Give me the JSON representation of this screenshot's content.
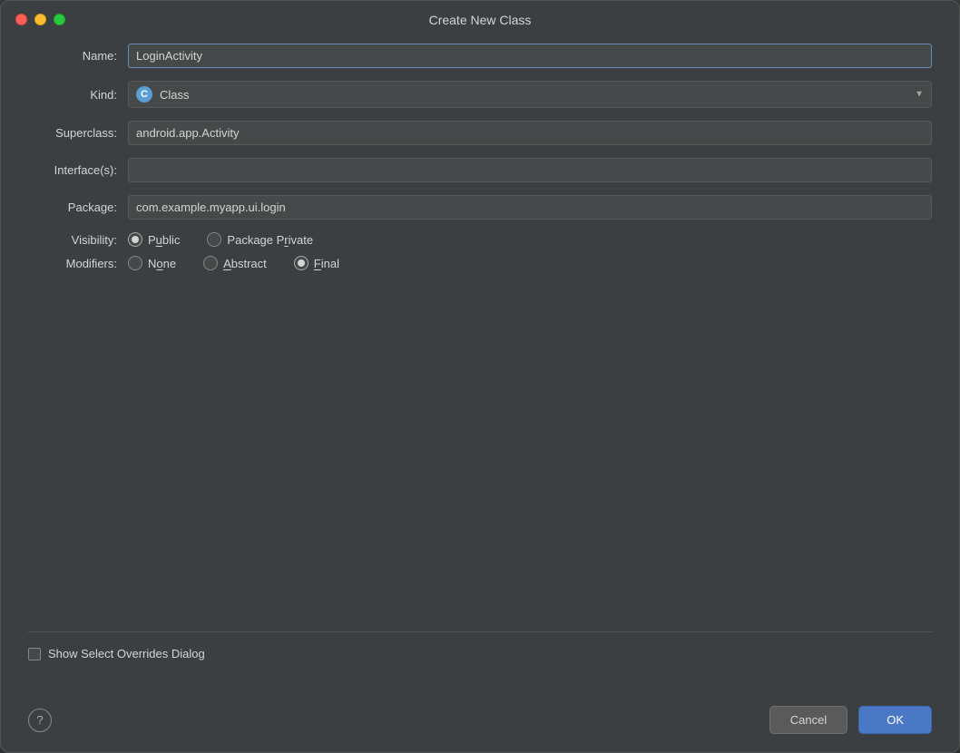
{
  "window": {
    "title": "Create New Class",
    "controls": {
      "close": "close",
      "minimize": "minimize",
      "maximize": "maximize"
    }
  },
  "form": {
    "name_label": "Name:",
    "name_value": "LoginActivity",
    "kind_label": "Kind:",
    "kind_value": "Class",
    "kind_icon": "C",
    "superclass_label": "Superclass:",
    "superclass_value": "android.app.Activity",
    "interfaces_label": "Interface(s):",
    "interfaces_value": "",
    "package_label": "Package:",
    "package_value": "com.example.myapp.ui.login",
    "visibility_label": "Visibility:",
    "visibility_options": [
      {
        "label": "Public",
        "underline_char": "u",
        "checked": true
      },
      {
        "label": "Package Private",
        "underline_char": "r",
        "checked": false
      }
    ],
    "modifiers_label": "Modifiers:",
    "modifiers_options": [
      {
        "label": "None",
        "underline_char": "o",
        "checked": false
      },
      {
        "label": "Abstract",
        "underline_char": "A",
        "checked": false
      },
      {
        "label": "Final",
        "underline_char": "F",
        "checked": true
      }
    ],
    "checkbox_label": "Show Select Overrides Dialog",
    "checkbox_checked": false
  },
  "footer": {
    "help_label": "?",
    "cancel_label": "Cancel",
    "ok_label": "OK"
  }
}
